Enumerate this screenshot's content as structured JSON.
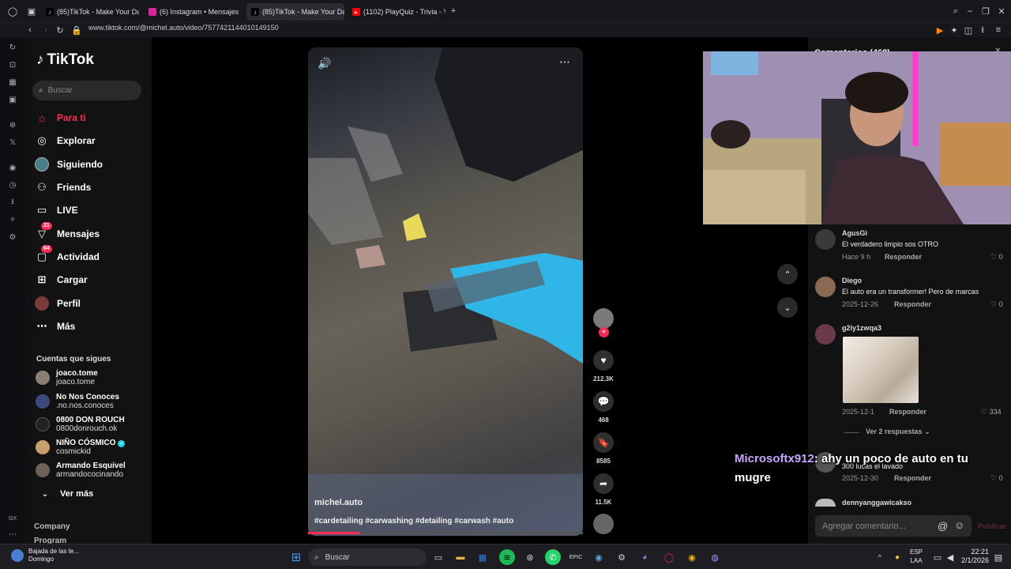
{
  "browser": {
    "tabs": [
      {
        "label": "(85)TikTok - Make Your Da",
        "icon": "tiktok-icon"
      },
      {
        "label": "(6) Instagram • Mensajes",
        "icon": "instagram-icon"
      },
      {
        "label": "(85)TikTok - Make Your Da",
        "icon": "tiktok-icon"
      },
      {
        "label": "(1102) PlayQuiz - Trivia - Y",
        "icon": "youtube-icon"
      }
    ],
    "url": "www.tiktok.com/@michel.auto/video/7577421144010149150"
  },
  "tiktok": {
    "logo": "TikTok",
    "search_placeholder": "Buscar",
    "nav": [
      {
        "label": "Para ti",
        "icon": "home-icon"
      },
      {
        "label": "Explorar",
        "icon": "compass-icon"
      },
      {
        "label": "Siguiendo",
        "icon": "following-icon"
      },
      {
        "label": "Friends",
        "icon": "friends-icon"
      },
      {
        "label": "LIVE",
        "icon": "live-icon"
      },
      {
        "label": "Mensajes",
        "icon": "messages-icon",
        "badge": "21"
      },
      {
        "label": "Actividad",
        "icon": "activity-icon",
        "badge": "64"
      },
      {
        "label": "Cargar",
        "icon": "upload-icon"
      },
      {
        "label": "Perfil",
        "icon": "profile-icon"
      },
      {
        "label": "Más",
        "icon": "more-icon"
      }
    ],
    "following_title": "Cuentas que sigues",
    "following": [
      {
        "name": "joaco.tome",
        "handle": "joaco.tome",
        "color": "#8a7f74"
      },
      {
        "name": "No Nos Conoces",
        "handle": ".no.nos.conoces",
        "color": "#3b4a7a"
      },
      {
        "name": "0800 DON ROUCH",
        "handle": "0800donrouch.ok",
        "color": "#222"
      },
      {
        "name": "NIÑO CÓSMICO",
        "handle": "cosmickid",
        "color": "#c9a06b",
        "verified": true
      },
      {
        "name": "Armando Esquivel",
        "handle": "armandococinando",
        "color": "#6d6258"
      }
    ],
    "see_more": "Ver más",
    "footer": [
      "Company",
      "Program"
    ]
  },
  "video": {
    "author": "michel.auto",
    "hashtags": "#cardetailing #carwashing #detailing #carwash #auto",
    "progress": 0.19,
    "likes": "212.3K",
    "comments": "468",
    "saves": "8585",
    "shares": "11.5K"
  },
  "comments_panel": {
    "header": "Comentarios (468)",
    "items": [
      {
        "user": "AgusGi",
        "text": "El verdadero limpio sos OTRO",
        "date": "Hace 9 h",
        "reply": "Responder",
        "likes": "0"
      },
      {
        "user": "Diego",
        "text": "El auto era un transformer! Pero de marcas",
        "date": "2025-12-26",
        "reply": "Responder",
        "likes": "0"
      },
      {
        "user": "g2iy1zwqa3",
        "text": "",
        "date": "2025-12-1",
        "reply": "Responder",
        "likes": "334"
      },
      {
        "user": "",
        "text": "300 lucas el lavado",
        "date": "2025-12-30",
        "reply": "Responder",
        "likes": "0"
      },
      {
        "user": "dennyanggawicakso",
        "text": "",
        "date": "",
        "reply": "",
        "likes": ""
      }
    ],
    "view_replies": "Ver 2 respuestas",
    "input_placeholder": "Agregar comentario...",
    "publish": "Publicar"
  },
  "stream_chat": {
    "user": "Microsoftx912",
    "message": ": ahy un poco de auto en tu mugre"
  },
  "taskbar": {
    "weather_title": "Bajada de las te...",
    "weather_sub": "Domingo",
    "search": "Buscar",
    "lang_top": "ESP",
    "lang_bottom": "LAA",
    "time": "22:21",
    "date": "2/1/2026"
  }
}
